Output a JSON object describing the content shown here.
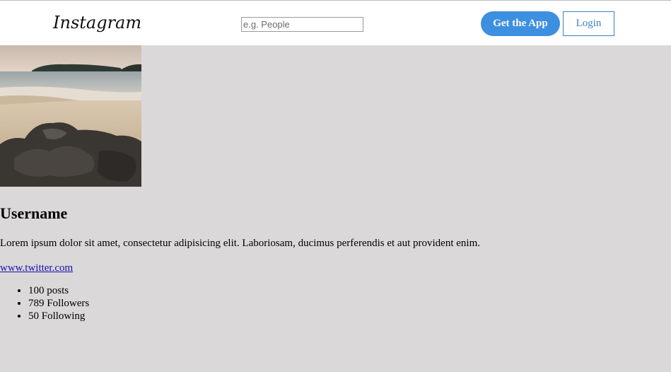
{
  "header": {
    "logo": "Instagram",
    "search_placeholder": "e.g. People",
    "get_app_label": "Get the App",
    "login_label": "Login"
  },
  "profile": {
    "username": "Username",
    "bio": "Lorem ipsum dolor sit amet, consectetur adipisicing elit. Laboriosam, ducimus perferendis et aut provident enim.",
    "website": "www.twitter.com",
    "stats": [
      {
        "text": "100 posts"
      },
      {
        "text": "789 Followers"
      },
      {
        "text": "50 Following"
      }
    ]
  },
  "colors": {
    "background": "#dbd8d9",
    "accent": "#3d8fe0",
    "login_border": "#3b7fc4",
    "link": "#1a0dab"
  }
}
